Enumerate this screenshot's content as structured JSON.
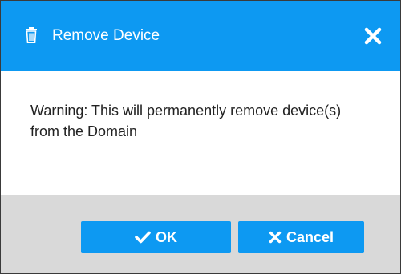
{
  "dialog": {
    "title": "Remove Device",
    "title_icon": "trash-icon",
    "close_icon": "close-icon",
    "message": "Warning: This will permanently remove device(s) from the Domain",
    "ok_label": "OK",
    "ok_icon": "check-icon",
    "cancel_label": "Cancel",
    "cancel_icon": "x-icon"
  },
  "colors": {
    "header": "#0d99f2",
    "footer": "#d9d9d9",
    "button": "#0d99f2",
    "text": "#222222"
  }
}
